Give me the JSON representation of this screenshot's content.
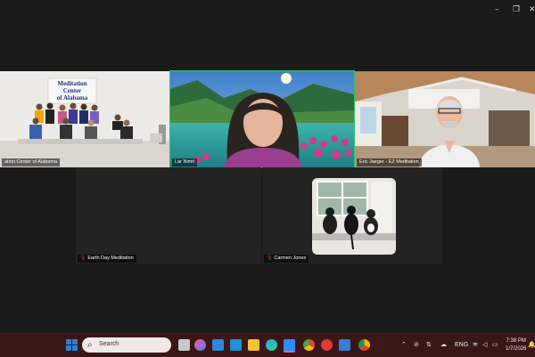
{
  "window_controls": {
    "minimize": "–",
    "restore": "❐",
    "close": "✕"
  },
  "participants": [
    {
      "name": "ation Center of Alabama",
      "banner_line1": "Meditation",
      "banner_line2": "Center",
      "banner_line3": "of Alabama",
      "muted": false
    },
    {
      "name": "Lar Nimit",
      "muted": false,
      "active_speaker": true
    },
    {
      "name": "Eric Jaeger - EZ Meditation",
      "muted": false
    },
    {
      "name": "Earth Day Meditation",
      "muted": true
    },
    {
      "name": "Carmen Jones",
      "muted": true
    }
  ],
  "taskbar": {
    "search_placeholder": "Search",
    "language": "ENG",
    "time": "7:38 PM",
    "date": "1/7/2026",
    "apps": [
      "file-explorer-icon",
      "copilot-icon",
      "mail-icon",
      "store-icon",
      "folder-icon",
      "edge-icon",
      "zoom-icon",
      "chrome-icon",
      "media-icon",
      "notepad-icon",
      "chrome-canary-icon"
    ]
  },
  "colors": {
    "active_speaker_border": "#2ec46b",
    "taskbar_bg": "#3a1616",
    "window_bg": "#1a1a1a"
  }
}
